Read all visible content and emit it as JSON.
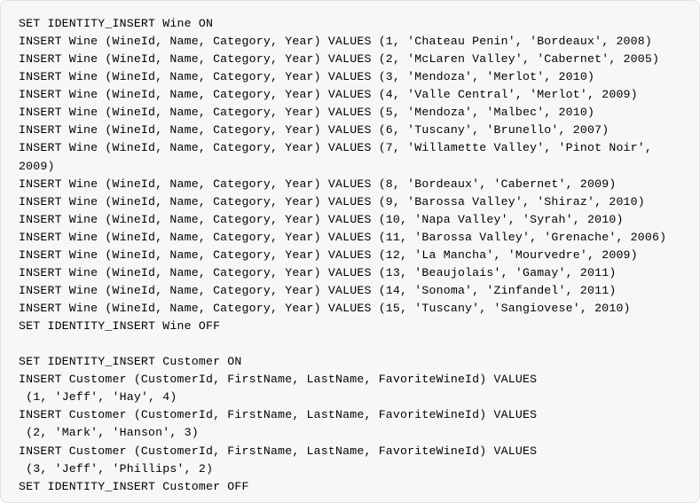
{
  "code": {
    "lines": [
      "SET IDENTITY_INSERT Wine ON",
      "INSERT Wine (WineId, Name, Category, Year) VALUES (1, 'Chateau Penin', 'Bordeaux', 2008)",
      "INSERT Wine (WineId, Name, Category, Year) VALUES (2, 'McLaren Valley', 'Cabernet', 2005)",
      "INSERT Wine (WineId, Name, Category, Year) VALUES (3, 'Mendoza', 'Merlot', 2010)",
      "INSERT Wine (WineId, Name, Category, Year) VALUES (4, 'Valle Central', 'Merlot', 2009)",
      "INSERT Wine (WineId, Name, Category, Year) VALUES (5, 'Mendoza', 'Malbec', 2010)",
      "INSERT Wine (WineId, Name, Category, Year) VALUES (6, 'Tuscany', 'Brunello', 2007)",
      "INSERT Wine (WineId, Name, Category, Year) VALUES (7, 'Willamette Valley', 'Pinot Noir', 2009)",
      "INSERT Wine (WineId, Name, Category, Year) VALUES (8, 'Bordeaux', 'Cabernet', 2009)",
      "INSERT Wine (WineId, Name, Category, Year) VALUES (9, 'Barossa Valley', 'Shiraz', 2010)",
      "INSERT Wine (WineId, Name, Category, Year) VALUES (10, 'Napa Valley', 'Syrah', 2010)",
      "INSERT Wine (WineId, Name, Category, Year) VALUES (11, 'Barossa Valley', 'Grenache', 2006)",
      "INSERT Wine (WineId, Name, Category, Year) VALUES (12, 'La Mancha', 'Mourvedre', 2009)",
      "INSERT Wine (WineId, Name, Category, Year) VALUES (13, 'Beaujolais', 'Gamay', 2011)",
      "INSERT Wine (WineId, Name, Category, Year) VALUES (14, 'Sonoma', 'Zinfandel', 2011)",
      "INSERT Wine (WineId, Name, Category, Year) VALUES (15, 'Tuscany', 'Sangiovese', 2010)",
      "SET IDENTITY_INSERT Wine OFF",
      "",
      "SET IDENTITY_INSERT Customer ON",
      "INSERT Customer (CustomerId, FirstName, LastName, FavoriteWineId) VALUES",
      " (1, 'Jeff', 'Hay', 4)",
      "INSERT Customer (CustomerId, FirstName, LastName, FavoriteWineId) VALUES",
      " (2, 'Mark', 'Hanson', 3)",
      "INSERT Customer (CustomerId, FirstName, LastName, FavoriteWineId) VALUES",
      " (3, 'Jeff', 'Phillips', 2)",
      "SET IDENTITY_INSERT Customer OFF"
    ]
  }
}
